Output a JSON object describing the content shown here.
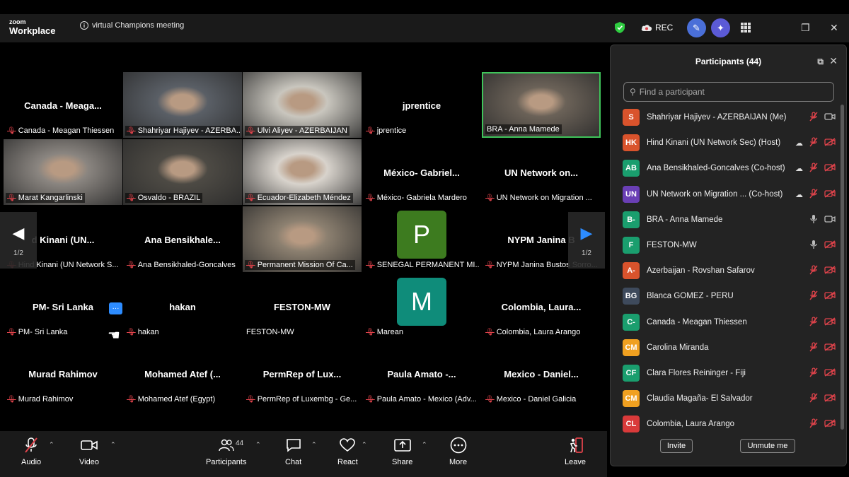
{
  "app": {
    "logo_top": "zoom",
    "logo_bottom": "Workplace",
    "meeting_title": "virtual Champions meeting"
  },
  "titlebar": {
    "rec_label": "REC"
  },
  "tiles": [
    {
      "big": "Canada - Meaga...",
      "label": "Canada - Meagan Thiessen",
      "muted": true
    },
    {
      "big": "",
      "label": "Shahriyar Hajiyev - AZERBA...",
      "muted": true,
      "video": "#5a5f66"
    },
    {
      "big": "",
      "label": "Ulvi Aliyev - AZERBAIJAN",
      "muted": true,
      "video": "#c9c6be"
    },
    {
      "big": "jprentice",
      "label": "jprentice",
      "muted": true
    },
    {
      "big": "",
      "label": "BRA - Anna Mamede",
      "muted": false,
      "video": "#6b6258",
      "active": true
    },
    {
      "big": "",
      "label": "Marat Kangarlinski",
      "muted": true,
      "video": "#8a8580"
    },
    {
      "big": "",
      "label": "Osvaldo - BRAZIL",
      "muted": true,
      "video": "#4d4a44"
    },
    {
      "big": "",
      "label": "Ecuador-Elizabeth Méndez",
      "muted": true,
      "video": "#d8d3cc"
    },
    {
      "big": "México- Gabriel...",
      "label": "México- Gabriela Mardero",
      "muted": true
    },
    {
      "big": "UN Network on...",
      "label": "UN Network on Migration ...",
      "muted": true
    },
    {
      "big": "d Kinani (UN...",
      "label": "Hind Kinani (UN Network S...",
      "muted": true
    },
    {
      "big": "Ana Bensikhale...",
      "label": "Ana Bensikhaled-Goncalves",
      "muted": true
    },
    {
      "big": "",
      "label": "Permanent Mission Of Ca...",
      "muted": true,
      "video": "#8c8070"
    },
    {
      "big": "",
      "label": "SENEGAL PERMANENT MI...",
      "muted": true,
      "avatar": "P",
      "avatar_color": "#3d7b1f"
    },
    {
      "big": "NYPM Janina B",
      "label": "NYPM Janina Bustos Sorro...",
      "muted": true
    },
    {
      "big": "PM- Sri Lanka",
      "label": "PM- Sri Lanka",
      "muted": true
    },
    {
      "big": "hakan",
      "label": "hakan",
      "muted": true
    },
    {
      "big": "FESTON-MW",
      "label": "FESTON-MW",
      "muted": false
    },
    {
      "big": "",
      "label": "Marean",
      "muted": true,
      "avatar": "M",
      "avatar_color": "#0f8c7a"
    },
    {
      "big": "Colombia, Laura...",
      "label": "Colombia, Laura Arango",
      "muted": true
    },
    {
      "big": "Murad Rahimov",
      "label": "Murad Rahimov",
      "muted": true
    },
    {
      "big": "Mohamed Atef (...",
      "label": "Mohamed Atef (Egypt)",
      "muted": true
    },
    {
      "big": "PermRep of Lux...",
      "label": "PermRep of Luxembg - Ge...",
      "muted": true
    },
    {
      "big": "Paula Amato -...",
      "label": "Paula Amato - Mexico (Adv...",
      "muted": true
    },
    {
      "big": "Mexico - Daniel...",
      "label": "Mexico - Daniel Galicia",
      "muted": true
    }
  ],
  "pager": {
    "left": "1/2",
    "right": "1/2"
  },
  "toolbar": {
    "audio": "Audio",
    "video": "Video",
    "participants": "Participants",
    "participants_count": "44",
    "chat": "Chat",
    "react": "React",
    "share": "Share",
    "more": "More",
    "leave": "Leave"
  },
  "panel": {
    "title": "Participants (44)",
    "search_placeholder": "Find a participant",
    "invite": "Invite",
    "unmute_me": "Unmute me",
    "participants": [
      {
        "initials": "S",
        "color": "#d9532c",
        "name": "Shahriyar Hajiyev - AZERBAIJAN (Me)",
        "mic": "off",
        "video": "on",
        "cloud": false
      },
      {
        "initials": "HK",
        "color": "#d9532c",
        "name": "Hind Kinani (UN Network Sec) (Host)",
        "mic": "off",
        "video": "off",
        "cloud": true
      },
      {
        "initials": "AB",
        "color": "#1a9e6e",
        "name": "Ana Bensikhaled-Goncalves (Co-host)",
        "mic": "off",
        "video": "off",
        "cloud": true
      },
      {
        "initials": "UN",
        "color": "#6a3fb5",
        "name": "UN Network on Migration ... (Co-host)",
        "mic": "off",
        "video": "off",
        "cloud": true
      },
      {
        "initials": "B-",
        "color": "#1a9e6e",
        "name": "BRA - Anna Mamede",
        "mic": "on",
        "video": "on",
        "cloud": false
      },
      {
        "initials": "F",
        "color": "#1a9e6e",
        "name": "FESTON-MW",
        "mic": "on",
        "video": "off",
        "cloud": false
      },
      {
        "initials": "A-",
        "color": "#d9532c",
        "name": "Azerbaijan - Rovshan Safarov",
        "mic": "off",
        "video": "off",
        "cloud": false
      },
      {
        "initials": "BG",
        "color": "#3e4a5c",
        "name": "Blanca GOMEZ - PERU",
        "mic": "off",
        "video": "off",
        "cloud": false
      },
      {
        "initials": "C-",
        "color": "#1a9e6e",
        "name": "Canada - Meagan Thiessen",
        "mic": "off",
        "video": "off",
        "cloud": false
      },
      {
        "initials": "CM",
        "color": "#f0a020",
        "name": "Carolina Miranda",
        "mic": "off",
        "video": "off",
        "cloud": false
      },
      {
        "initials": "CF",
        "color": "#1a9e6e",
        "name": "Clara Flores Reininger - Fiji",
        "mic": "off",
        "video": "off",
        "cloud": false
      },
      {
        "initials": "CM",
        "color": "#f0a020",
        "name": "Claudia Magaña- El Salvador",
        "mic": "off",
        "video": "off",
        "cloud": false
      },
      {
        "initials": "CL",
        "color": "#d93a3a",
        "name": "Colombia, Laura Arango",
        "mic": "off",
        "video": "off",
        "cloud": false
      }
    ]
  }
}
